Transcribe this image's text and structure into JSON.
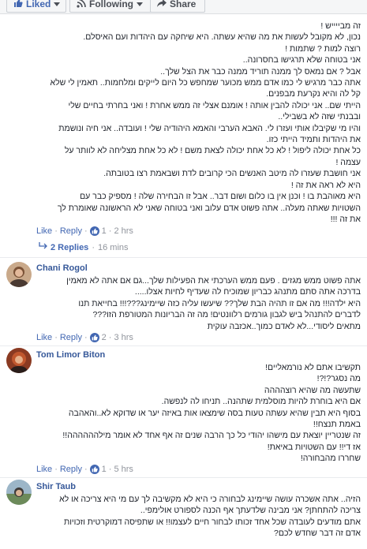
{
  "toolbar": {
    "liked_label": "Liked",
    "following_label": "Following",
    "share_label": "Share"
  },
  "comments": [
    {
      "lines": [
        "זה מבייייש !",
        "נכון, לא מקובל לעשות את מה שהיא עשתה. היא שיחקה עם היהדות ועם האיסלם.",
        "רוצה למות ? שתמות !",
        "אני בטוחה שלא תרגישו בחסרונה..",
        "אבל ? אם נמאס לך ממנה תוריד ממנה כבר את הצל שלך..",
        "אתה כבר מרגיש לי כמו אדם ממש מכוער שמחפש כל היום לייקים ומלחמות.. תאמין לי שלא",
        "קל לה והיא נקרעת מבפנים.",
        "הייתי שם.. אני יכולה להבין אותה ! אומנם אצלי זה ממש אחרת ! ואני בחרתי בחיים שלי",
        "ובבנתי שזה לא בשבילי..",
        "והיו מי שקיבלו אותי ועזרו לי. האבא הערבי והאמא היהודיה שלי ! ועובדה.. אני חיה ונושמת",
        "את היהדות ותמיד הייתי כזו.",
        "כל אחת יכולה ליפול ! לא כל אחת יכולה לצאת משם ! לא כל אחת מצליחה לא לוותר על",
        "עצמה !",
        "אני חושבת שעזרו לה מיטב האנשים הכי קרובים לדת ושבאמת רצו בטובתה.",
        "היא לא ראה את זה !",
        "היא מאוהבת בו ! וכנן אין בו כלום ושום דבר.. אבל זו הבחירה שלה ! מספיק כבר עם",
        "השטויות שאתה מעלה.. אתה פשוט אדם עלוב ואני בטוחה שאני לא הראשונה שאומרת לך",
        "את זה !!!"
      ],
      "actions": {
        "like": "Like",
        "reply": "Reply",
        "like_count": "1",
        "time": "2 hrs"
      },
      "replies": {
        "label": "2 Replies",
        "time": "16 mins"
      }
    },
    {
      "author": "Chani Rogol",
      "lines": [
        "אתה פשוט ממש מגזים . פעם ממש הערכתי את הפעילות שלך...גם אם אתה לא מאמין",
        "בדרכה אתה סתם מתנהג כבריון שמוכיח לה שעדיף לחיות אצלו.....",
        "היא ילדה!!! מה אם זו תהיה הבת שלך?? שיעשו עליה כזה שיימינג???!!! בחייאת תנו",
        "לדברים להתנהל ביש לגבון גורמים רלוונטים! מה זה הבריונות המטורפת הזו???",
        "מתאים ליסודי...לא לאדם כמוך..אכזבה עוקית"
      ],
      "actions": {
        "like": "Like",
        "reply": "Reply",
        "like_count": "2",
        "time": "3 hrs"
      }
    },
    {
      "author": "Tom Limor Biton",
      "lines": [
        "תקשיבו אתם לא נורמאליים!",
        "מה נסגר?!?!",
        "שתעשה מה שהיא רוצהההה",
        "אם היא בוחרת להיות מוסלמית שתהנה.. תניחו לה לנפשה.",
        "בסוף היא תבין שהיא עשתה טעות בסה שימצאו אות באיזה יער או שדוקא לא..והאהבה",
        "באמת תנצח!!",
        "זה שנטריין יוצאת עם מישהו יהודי כל כך הרבה שנים זה אף אחד לא אומר מילהההההה!!",
        "אז די!! עם השטויות באיאת!",
        "שחררו מהבחורה!"
      ],
      "actions": {
        "like": "Like",
        "reply": "Reply",
        "like_count": "1",
        "time": "5 hrs"
      }
    },
    {
      "author": "Shir Taub",
      "lines": [
        "הזיה.. אתה אשכרה עושה שיימינג לבחורה כי היא לא מקשיבה לך עם מי היא צריכה או לא",
        "צריכה להתחתן? אני מבינה שלדעתך אף הכנה לספורט אולימפי..",
        "אתם מודעים לעובדה שכל אחד זכותו לבחור חיים לעצמו!! או שתפיסה דמוקרטית וזכויות",
        "אדם זה דבר שחדש לכם?"
      ]
    }
  ]
}
